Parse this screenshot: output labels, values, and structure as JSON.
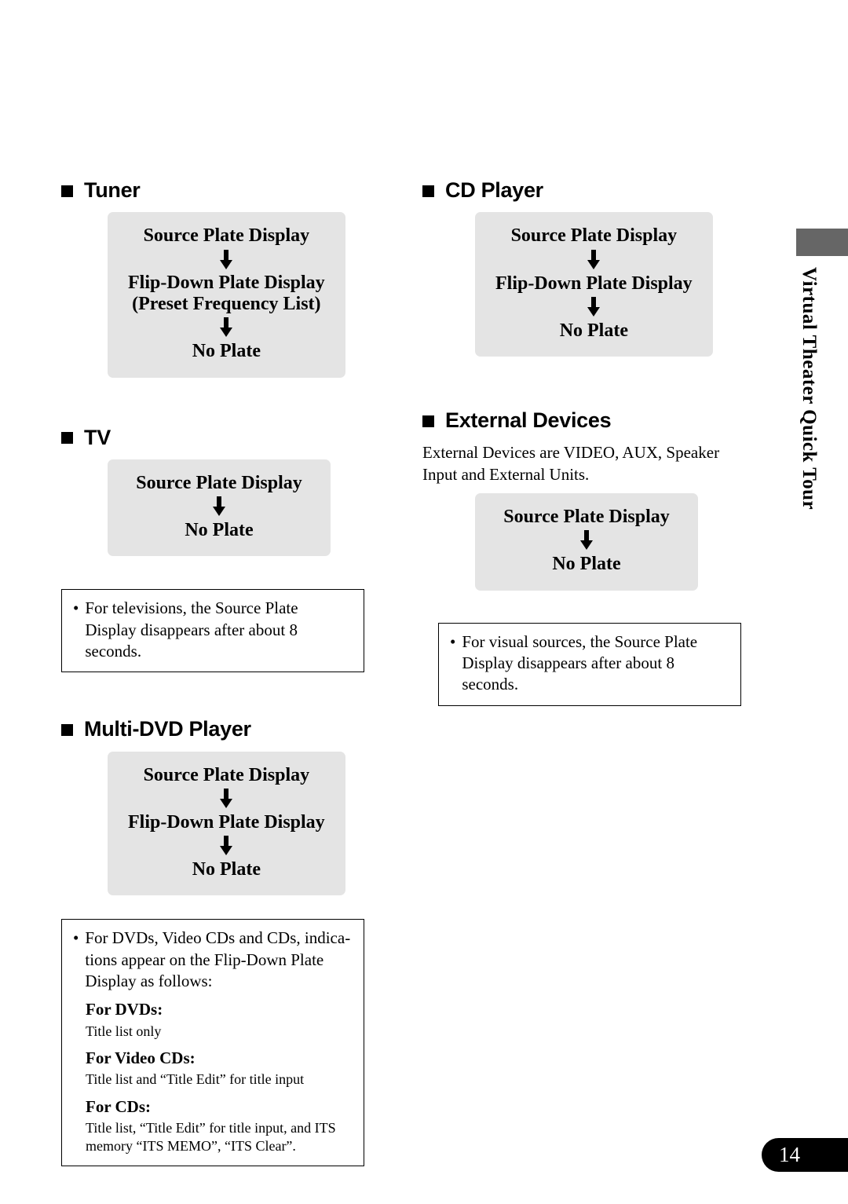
{
  "page": {
    "number": "14",
    "side_tab": "Virtual Theater Quick Tour"
  },
  "icons": {
    "square_bullet": "square-bullet-icon",
    "down_arrow": "down-arrow-icon",
    "list_bullet": "•"
  },
  "colors": {
    "flow_box_bg": "#e4e4e4",
    "side_tab_block": "#666666",
    "page_num_bg": "#000000",
    "text": "#000000"
  },
  "sections": {
    "tuner": {
      "heading": "Tuner",
      "steps": [
        "Source Plate Display",
        "Flip-Down Plate Display",
        "(Preset Frequency List)",
        "No Plate"
      ]
    },
    "tv": {
      "heading": "TV",
      "steps": [
        "Source Plate Display",
        "No Plate"
      ],
      "note": "For televisions, the Source Plate Display disappears after about 8 seconds."
    },
    "multi_dvd": {
      "heading": "Multi-DVD Player",
      "steps": [
        "Source Plate Display",
        "Flip-Down Plate Display",
        "No Plate"
      ],
      "note_intro": "For DVDs, Video CDs and CDs, indica-tions appear on the Flip-Down Plate Display as follows:",
      "note_items": [
        {
          "label": "For DVDs:",
          "body": "Title list only"
        },
        {
          "label": "For Video CDs:",
          "body": "Title list and “Title Edit” for title input"
        },
        {
          "label": "For CDs:",
          "body": "Title list, “Title Edit” for title input, and ITS memory “ITS MEMO”, “ITS Clear”."
        }
      ]
    },
    "cd_player": {
      "heading": "CD Player",
      "steps": [
        "Source Plate Display",
        "Flip-Down Plate Display",
        "No Plate"
      ]
    },
    "external_devices": {
      "heading": "External Devices",
      "intro": "External Devices are VIDEO, AUX, Speaker Input and External Units.",
      "steps": [
        "Source Plate Display",
        "No Plate"
      ],
      "note": "For visual sources, the Source Plate Display disappears after about 8 seconds."
    }
  }
}
